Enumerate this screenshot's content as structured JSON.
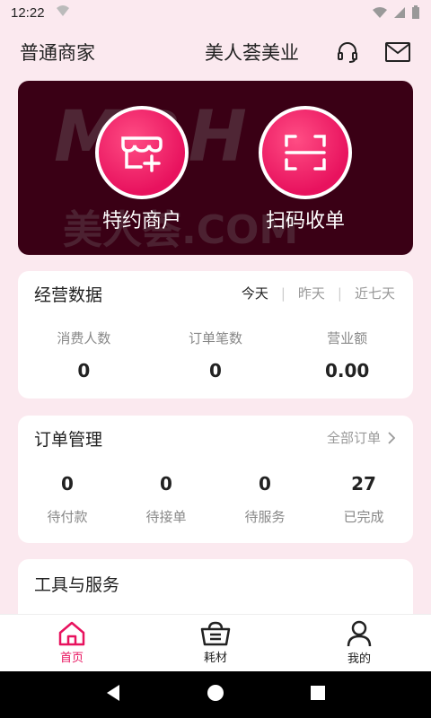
{
  "status_bar": {
    "time": "12:22"
  },
  "header": {
    "role": "普通商家",
    "shop_name": "美人荟美业",
    "headset_icon": "headset-icon",
    "mail_icon": "mail-icon"
  },
  "banner": {
    "watermark_text": "MRH",
    "watermark_sub": "美人荟.COM",
    "actions": [
      {
        "label": "特约商户",
        "icon": "shop-add-icon"
      },
      {
        "label": "扫码收单",
        "icon": "scan-icon"
      }
    ]
  },
  "business": {
    "title": "经营数据",
    "ranges": [
      "今天",
      "昨天",
      "近七天"
    ],
    "active_range": "今天",
    "stats": [
      {
        "label": "消费人数",
        "value": "0"
      },
      {
        "label": "订单笔数",
        "value": "0"
      },
      {
        "label": "营业额",
        "value": "0.00"
      }
    ]
  },
  "orders": {
    "title": "订单管理",
    "all_link": "全部订单",
    "stats": [
      {
        "label": "待付款",
        "value": "0"
      },
      {
        "label": "待接单",
        "value": "0"
      },
      {
        "label": "待服务",
        "value": "0"
      },
      {
        "label": "已完成",
        "value": "27"
      }
    ]
  },
  "tools": {
    "title": "工具与服务"
  },
  "tabbar": {
    "tabs": [
      {
        "label": "首页",
        "icon": "home-icon",
        "active": true
      },
      {
        "label": "耗材",
        "icon": "basket-icon",
        "active": false
      },
      {
        "label": "我的",
        "icon": "person-icon",
        "active": false
      }
    ]
  },
  "colors": {
    "accent": "#e8125e",
    "banner_bg": "#3a0015",
    "page_bg": "#fbe9ef"
  }
}
